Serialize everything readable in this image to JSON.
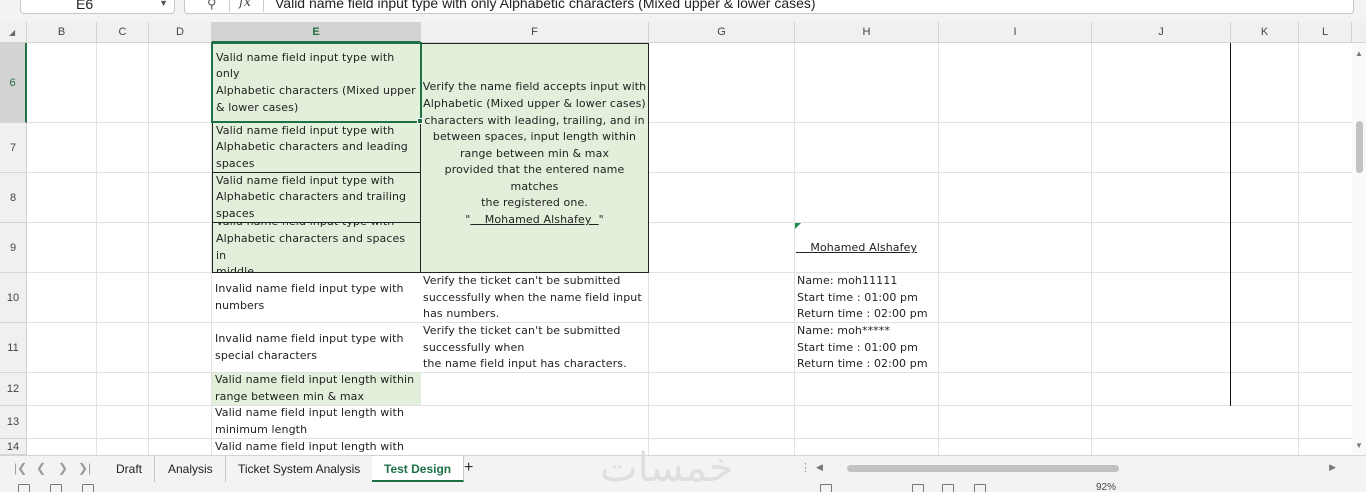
{
  "formula_bar": {
    "name_box": "E6",
    "formula": "Valid name field input type with only Alphabetic characters  (Mixed upper & lower cases)"
  },
  "columns": [
    "B",
    "C",
    "D",
    "E",
    "F",
    "G",
    "H",
    "I",
    "J",
    "K",
    "L"
  ],
  "rows": [
    "6",
    "7",
    "8",
    "9",
    "10",
    "11",
    "12",
    "13",
    "14"
  ],
  "cells": {
    "E6": [
      "Valid name field input type with only",
      "Alphabetic characters  (Mixed upper",
      "& lower cases)"
    ],
    "E7": [
      "Valid name field input type with",
      "Alphabetic characters and leading",
      "spaces"
    ],
    "E8": [
      "Valid name field input type with",
      "Alphabetic characters and trailing",
      "spaces"
    ],
    "E9": [
      "Valid name field input type with",
      "Alphabetic characters and spaces in",
      "middle"
    ],
    "E10": [
      "Invalid name field input type with",
      "numbers"
    ],
    "E11": [
      "Invalid name field input type with",
      "special characters"
    ],
    "E12": [
      "Valid name field input length within",
      "range between min & max"
    ],
    "E13": [
      "Valid name field input length with",
      "minimum length"
    ],
    "E14": [
      "Valid name field input length with"
    ],
    "F6": [
      "Verify the name field accepts input with",
      "Alphabetic (Mixed upper & lower cases)",
      "characters with leading, trailing, and in",
      "between spaces, input length within",
      "range between min & max",
      "provided that the entered name matches",
      "the registered one."
    ],
    "F6_name_prefix": "\"",
    "F6_name": "    Mohamed Alshafey  ",
    "F6_name_suffix": "\"",
    "F10": [
      "Verify the ticket can't be submitted",
      "successfully when the name field input",
      "has numbers."
    ],
    "F11": [
      "Verify the ticket can't be submitted",
      "successfully when",
      "the name field input has characters."
    ],
    "H9": "    Mohamed Alshafey",
    "H10": [
      "Name: moh11111",
      "Start time : 01:00 pm",
      "Return time : 02:00 pm"
    ],
    "H11": [
      "Name: moh*****",
      "Start time : 01:00 pm",
      "Return time : 02:00 pm"
    ]
  },
  "sheet_tabs": [
    "Draft",
    "Analysis",
    "Ticket System Analysis",
    "Test Design"
  ],
  "active_tab": "Test Design",
  "watermark": "خمسات",
  "zoom": "92%",
  "colors": {
    "accent": "#1e7145",
    "fill_green": "#e2efda"
  }
}
